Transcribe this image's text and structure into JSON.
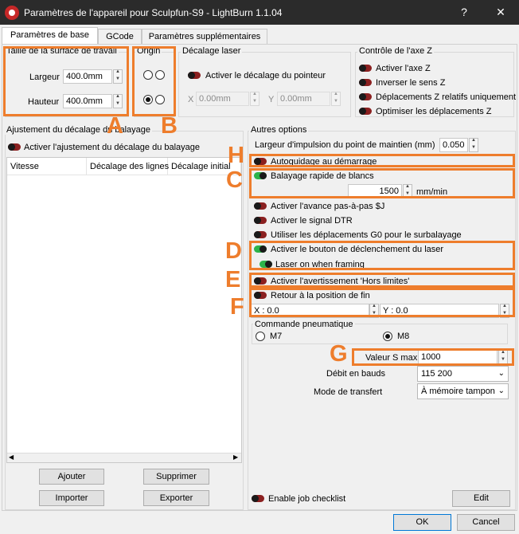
{
  "window": {
    "title": "Paramètres de l'appareil pour Sculpfun-S9 - LightBurn 1.1.04",
    "help_label": "?",
    "close_label": "✕"
  },
  "tabs": [
    "Paramètres de base",
    "GCode",
    "Paramètres supplémentaires"
  ],
  "work_area": {
    "title": "Taille de la surface de travail",
    "width_label": "Largeur",
    "width_value": "400.0mm",
    "height_label": "Hauteur",
    "height_value": "400.0mm"
  },
  "origin": {
    "title": "Origin"
  },
  "laser_offset": {
    "title": "Décalage laser",
    "enable_label": "Activer le décalage du pointeur",
    "x_label": "X",
    "x_value": "0.00mm",
    "y_label": "Y",
    "y_value": "0.00mm"
  },
  "z_axis": {
    "title": "Contrôle de l'axe Z",
    "items": [
      "Activer l'axe Z",
      "Inverser le sens Z",
      "Déplacements Z relatifs uniquement",
      "Optimiser les déplacements Z"
    ]
  },
  "scan_offset": {
    "title": "Ajustement du décalage du balayage",
    "enable_label": "Activer l'ajustement du décalage du balayage",
    "columns": [
      "Vitesse",
      "Décalage des lignes",
      "Décalage initial"
    ],
    "buttons": {
      "add": "Ajouter",
      "remove": "Supprimer",
      "import": "Importer",
      "export": "Exporter"
    }
  },
  "other": {
    "title": "Autres options",
    "dot_width_label": "Largeur d'impulsion du point de maintien (mm)",
    "dot_width_value": "0.050",
    "autohome": "Autoguidage au démarrage",
    "fast_whitespace": "Balayage rapide de blancs",
    "fast_whitespace_value": "1500",
    "fast_whitespace_unit": "mm/min",
    "jog": "Activer l'avance pas-à-pas $J",
    "dtr": "Activer le signal DTR",
    "g0": "Utiliser les déplacements G0 pour le surbalayage",
    "fire_button": "Activer le bouton de déclenchement du laser",
    "laser_framing": "Laser on when framing",
    "out_of_bounds": "Activer l'avertissement 'Hors limites'",
    "return_finish": "Retour à la position de fin",
    "finish_x": "X : 0.0",
    "finish_y": "Y : 0.0",
    "air_title": "Commande pneumatique",
    "air_m7": "M7",
    "air_m8": "M8",
    "s_max_label": "Valeur S max",
    "s_max_value": "1000",
    "baud_label": "Débit en bauds",
    "baud_value": "115 200",
    "transfer_label": "Mode de transfert",
    "transfer_value": "À mémoire tampon",
    "job_checklist": "Enable job checklist",
    "edit_label": "Edit"
  },
  "footer": {
    "ok": "OK",
    "cancel": "Cancel"
  },
  "callouts": [
    "A",
    "B",
    "C",
    "D",
    "E",
    "F",
    "G",
    "H"
  ],
  "colors": {
    "highlight": "#ee7d2c",
    "toggle_on": "#2db34a",
    "toggle_off": "#8b2020",
    "titlebar": "#2b2b2b"
  }
}
